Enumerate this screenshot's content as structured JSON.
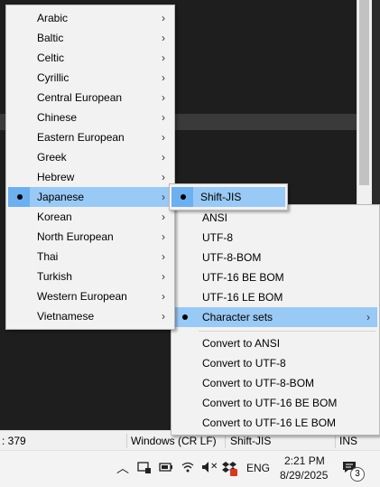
{
  "encoding_menu": {
    "items": [
      {
        "label": "Arabic",
        "arrow": "›"
      },
      {
        "label": "Baltic",
        "arrow": "›"
      },
      {
        "label": "Celtic",
        "arrow": "›"
      },
      {
        "label": "Cyrillic",
        "arrow": "›"
      },
      {
        "label": "Central European",
        "arrow": "›"
      },
      {
        "label": "Chinese",
        "arrow": "›"
      },
      {
        "label": "Eastern European",
        "arrow": "›"
      },
      {
        "label": "Greek",
        "arrow": "›"
      },
      {
        "label": "Hebrew",
        "arrow": "›"
      },
      {
        "label": "Japanese",
        "arrow": "›",
        "selected": true
      },
      {
        "label": "Korean",
        "arrow": "›"
      },
      {
        "label": "North European",
        "arrow": "›"
      },
      {
        "label": "Thai",
        "arrow": "›"
      },
      {
        "label": "Turkish",
        "arrow": "›"
      },
      {
        "label": "Western European",
        "arrow": "›"
      },
      {
        "label": "Vietnamese",
        "arrow": "›"
      }
    ]
  },
  "japanese_submenu": {
    "items": [
      {
        "label": "Shift-JIS",
        "selected": true
      }
    ]
  },
  "main_encoding_menu": {
    "items": [
      {
        "label": "ANSI"
      },
      {
        "label": "UTF-8"
      },
      {
        "label": "UTF-8-BOM"
      },
      {
        "label": "UTF-16 BE BOM"
      },
      {
        "label": "UTF-16 LE BOM"
      },
      {
        "label": "Character sets",
        "arrow": "›",
        "selected": true
      },
      {
        "label": "Convert to ANSI"
      },
      {
        "label": "Convert to UTF-8"
      },
      {
        "label": "Convert to UTF-8-BOM"
      },
      {
        "label": "Convert to UTF-16 BE BOM"
      },
      {
        "label": "Convert to UTF-16 LE BOM"
      }
    ]
  },
  "statusbar": {
    "position": ": 379",
    "eol": "Windows (CR LF)",
    "encoding": "Shift-JIS",
    "mode": "INS"
  },
  "taskbar": {
    "language": "ENG",
    "time": "2:21 PM",
    "date": "8/29/2025",
    "notification_count": "3",
    "chevron_glyph": "︿",
    "mute_glyph": "✕"
  },
  "colors": {
    "menu_bg": "#f2f2f2",
    "highlight": "#99c9f5",
    "editor_bg": "#1e1e1e"
  }
}
